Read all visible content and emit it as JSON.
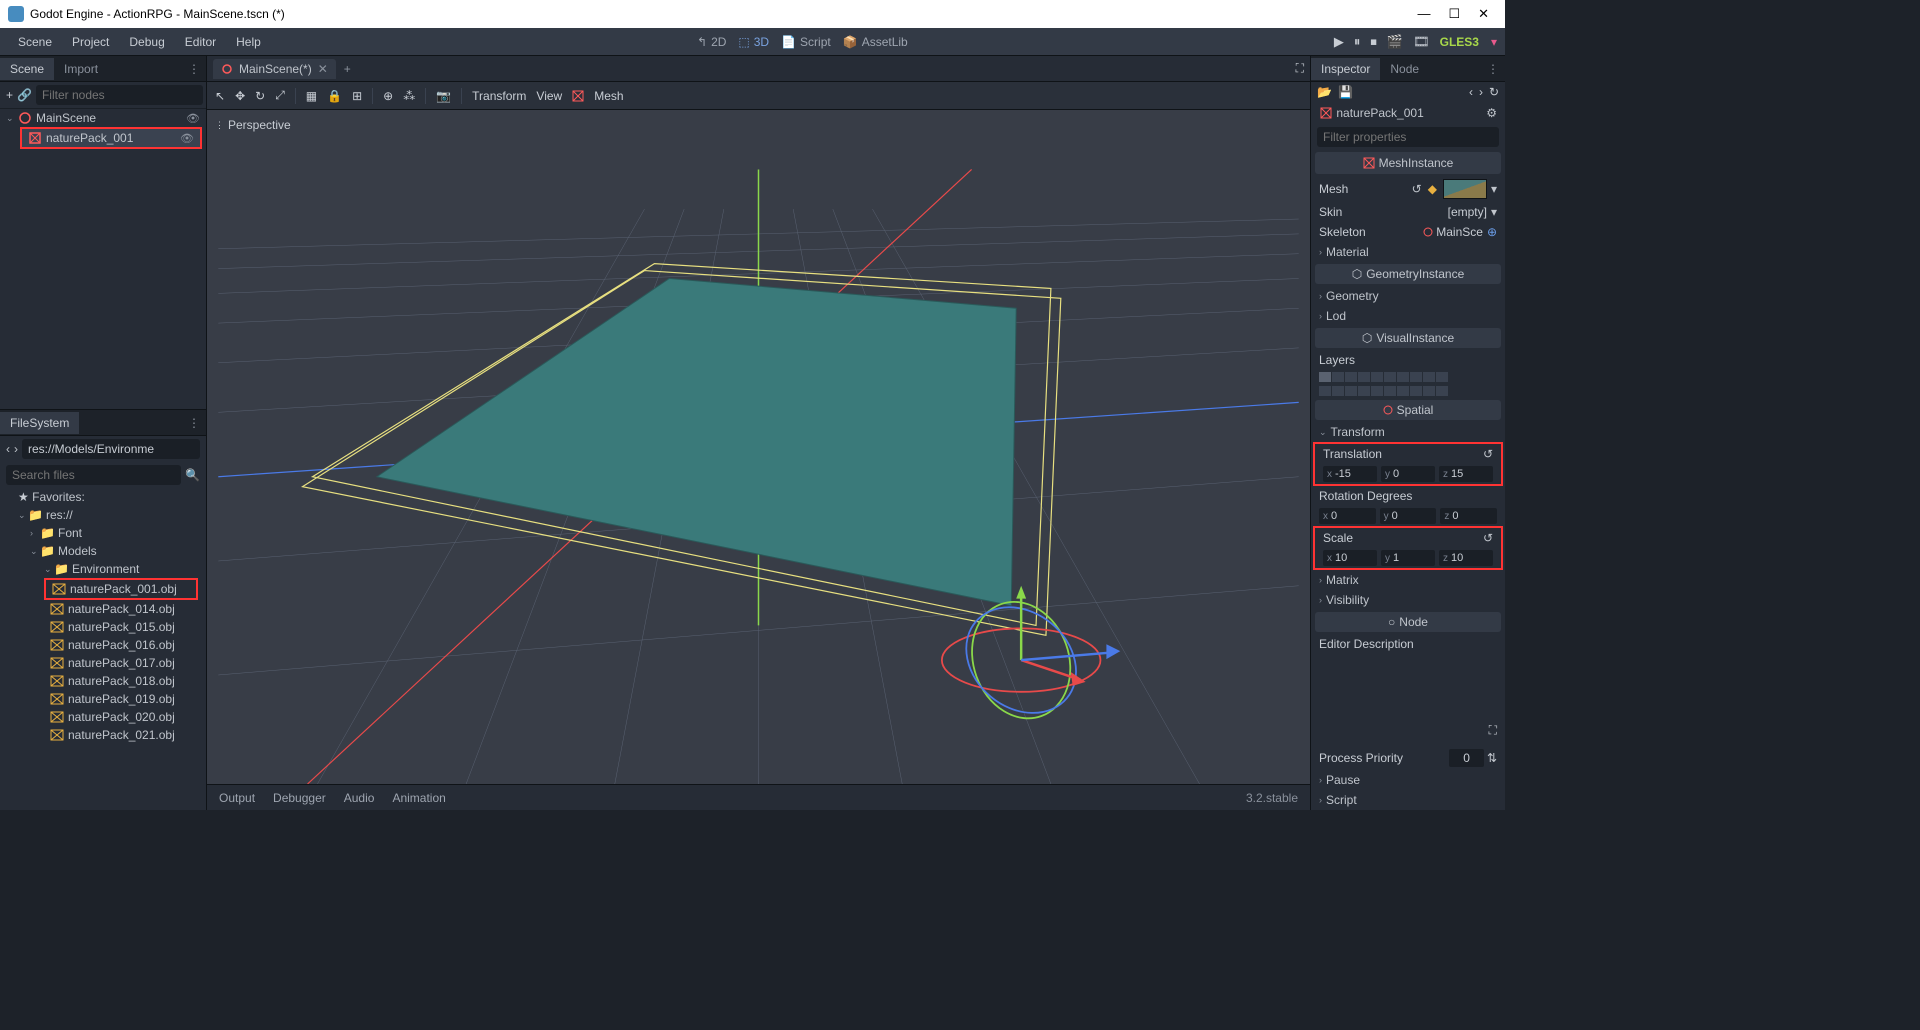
{
  "window": {
    "title": "Godot Engine - ActionRPG - MainScene.tscn (*)"
  },
  "menubar": {
    "items": [
      "Scene",
      "Project",
      "Debug",
      "Editor",
      "Help"
    ],
    "center": {
      "b2d": "2D",
      "b3d": "3D",
      "script": "Script",
      "assetlib": "AssetLib"
    },
    "gles": "GLES3"
  },
  "left": {
    "tabs": {
      "scene": "Scene",
      "import": "Import"
    },
    "filter_placeholder": "Filter nodes",
    "tree": {
      "root": "MainScene",
      "child": "naturePack_001"
    },
    "fs_tab": "FileSystem",
    "fs_path": "res://Models/Environme",
    "fs_search": "Search files",
    "fs_fav": "Favorites:",
    "fs_root": "res://",
    "fs_folders": {
      "font": "Font",
      "models": "Models",
      "env": "Environment"
    },
    "fs_files": [
      "naturePack_001.obj",
      "naturePack_014.obj",
      "naturePack_015.obj",
      "naturePack_016.obj",
      "naturePack_017.obj",
      "naturePack_018.obj",
      "naturePack_019.obj",
      "naturePack_020.obj",
      "naturePack_021.obj"
    ]
  },
  "center": {
    "tab": "MainScene(*)",
    "persp": "Perspective",
    "toolbar": {
      "transform": "Transform",
      "view": "View",
      "mesh": "Mesh"
    }
  },
  "bottom": {
    "output": "Output",
    "debugger": "Debugger",
    "audio": "Audio",
    "animation": "Animation",
    "version": "3.2.stable"
  },
  "inspector": {
    "tabs": {
      "inspector": "Inspector",
      "node": "Node"
    },
    "node_name": "naturePack_001",
    "filter_placeholder": "Filter properties",
    "class": "MeshInstance",
    "mesh_label": "Mesh",
    "skin_label": "Skin",
    "skin_val": "[empty]",
    "skeleton_label": "Skeleton",
    "skeleton_val": "MainSce",
    "material": "Material",
    "geom_inst": "GeometryInstance",
    "geometry": "Geometry",
    "lod": "Lod",
    "visual_inst": "VisualInstance",
    "layers": "Layers",
    "spatial": "Spatial",
    "transform": "Transform",
    "translation": "Translation",
    "trans": {
      "x": "-15",
      "y": "0",
      "z": "15"
    },
    "rotdeg": "Rotation Degrees",
    "rot": {
      "x": "0",
      "y": "0",
      "z": "0"
    },
    "scale": "Scale",
    "scl": {
      "x": "10",
      "y": "1",
      "z": "10"
    },
    "matrix": "Matrix",
    "visibility": "Visibility",
    "nodeclass": "Node",
    "editor_desc": "Editor Description",
    "proc_prio": "Process Priority",
    "proc_val": "0",
    "pause": "Pause",
    "script": "Script"
  }
}
